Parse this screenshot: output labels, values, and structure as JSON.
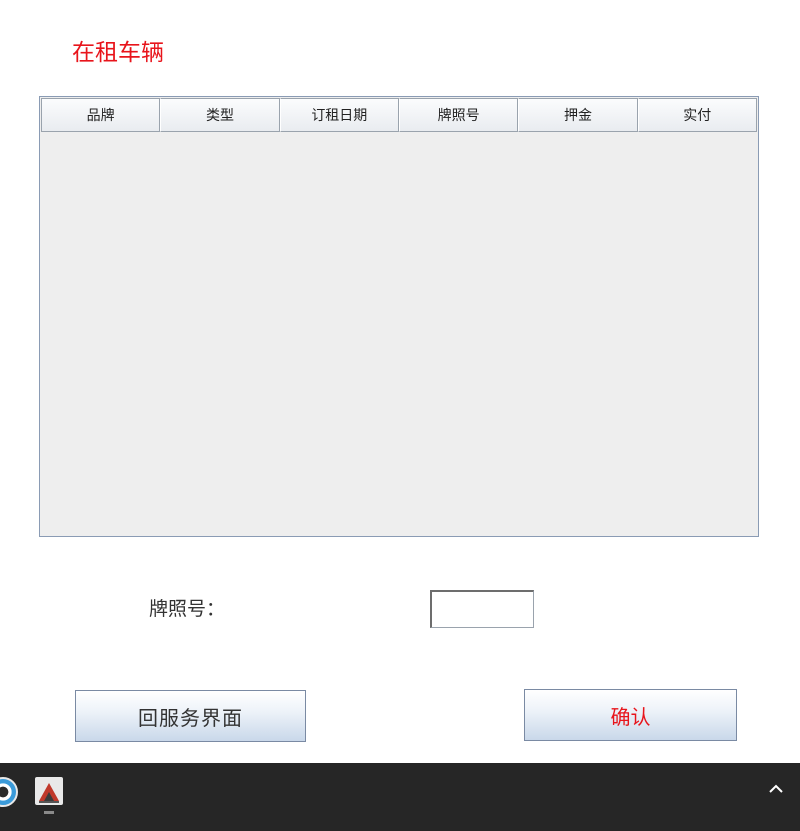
{
  "page_title": "在租车辆",
  "table": {
    "columns": [
      "品牌",
      "类型",
      "订租日期",
      "牌照号",
      "押金",
      "实付"
    ]
  },
  "form": {
    "plate_label": "牌照号：",
    "plate_value": ""
  },
  "buttons": {
    "back_label": "回服务界面",
    "confirm_label": "确认"
  },
  "colors": {
    "title": "#e8141b",
    "confirm_text": "#e8141b",
    "taskbar": "#262626"
  },
  "taskbar": {
    "icons": [
      "app-icon",
      "java-app-icon",
      "chevron-up-icon"
    ]
  }
}
